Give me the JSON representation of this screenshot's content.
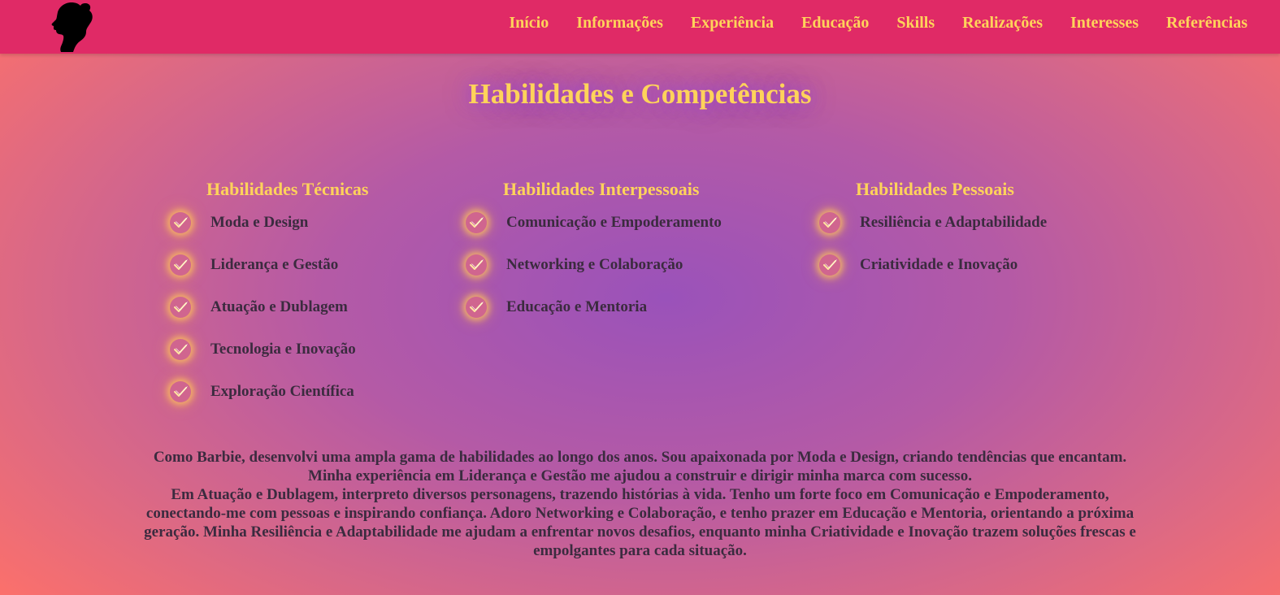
{
  "nav": {
    "links": [
      "Início",
      "Informações",
      "Experiência",
      "Educação",
      "Skills",
      "Realizações",
      "Interesses",
      "Referências"
    ]
  },
  "colors": {
    "navbar": "#e02a66",
    "accent": "#ffd35a",
    "text": "#3b2b3f"
  },
  "icons": {
    "logo": "silhouette-logo",
    "check": "check-circle-icon"
  },
  "section": {
    "title": "Habilidades e Competências"
  },
  "columns": [
    {
      "title": "Habilidades Técnicas",
      "items": [
        "Moda e Design",
        "Liderança e Gestão",
        "Atuação e Dublagem",
        "Tecnologia e Inovação",
        "Exploração Científica"
      ]
    },
    {
      "title": "Habilidades Interpessoais",
      "items": [
        "Comunicação e Empoderamento",
        "Networking e Colaboração",
        "Educação e Mentoria"
      ]
    },
    {
      "title": "Habilidades Pessoais",
      "items": [
        "Resiliência e Adaptabilidade",
        "Criatividade e Inovação"
      ]
    }
  ],
  "description": {
    "para1": "Como Barbie, desenvolvi uma ampla gama de habilidades ao longo dos anos. Sou apaixonada por Moda e Design, criando tendências que encantam. Minha experiência em Liderança e Gestão me ajudou a construir e dirigir minha marca com sucesso.",
    "para2": "Em Atuação e Dublagem, interpreto diversos personagens, trazendo histórias à vida. Tenho um forte foco em Comunicação e Empoderamento, conectando-me com pessoas e inspirando confiança. Adoro Networking e Colaboração, e tenho prazer em Educação e Mentoria, orientando a próxima geração. Minha Resiliência e Adaptabilidade me ajudam a enfrentar novos desafios, enquanto minha Criatividade e Inovação trazem soluções frescas e empolgantes para cada situação."
  }
}
